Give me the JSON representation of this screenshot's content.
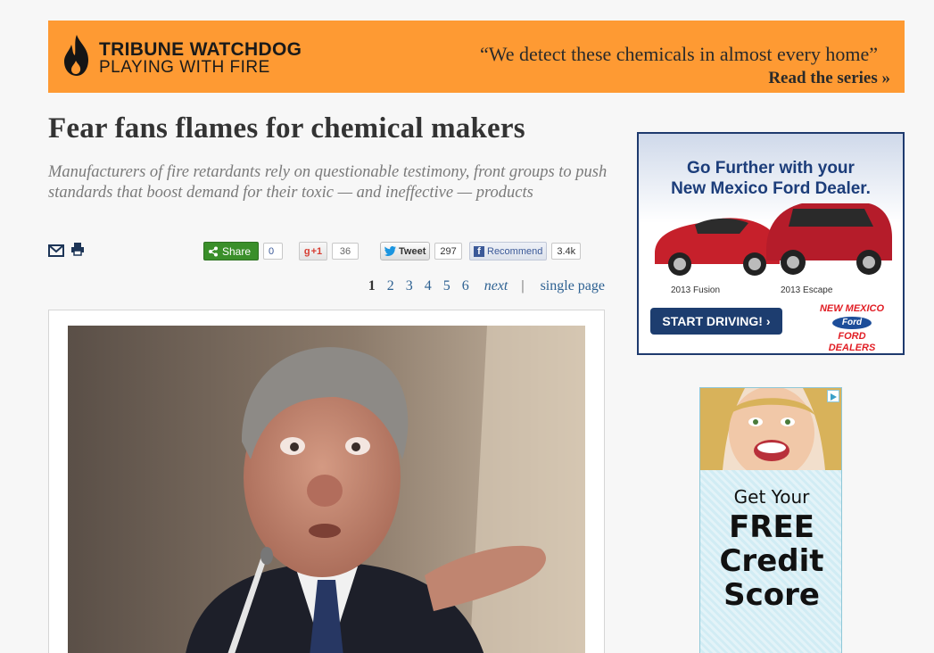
{
  "banner": {
    "brand_line1": "TRIBUNE WATCHDOG",
    "brand_line2": "PLAYING WITH FIRE",
    "quote": "“We detect these chemicals in almost every home”",
    "read_series": "Read the series »",
    "bg_color": "#fe9a33"
  },
  "article": {
    "headline": "Fear fans flames for chemical makers",
    "dek": "Manufacturers of fire retardants rely on questionable testimony, front groups to push standards that boost demand for their toxic — and ineffective — products"
  },
  "tools": {
    "email_icon": "envelope-icon",
    "print_icon": "printer-icon"
  },
  "social": {
    "share_label": "Share",
    "share_count": "0",
    "gplus_label": "+1",
    "gplus_count": "36",
    "tweet_label": "Tweet",
    "tweet_count": "297",
    "recommend_label": "Recommend",
    "recommend_count": "3.4k"
  },
  "pager": {
    "pages": [
      "1",
      "2",
      "3",
      "4",
      "5",
      "6"
    ],
    "current": "1",
    "next_label": "next",
    "separator": "|",
    "single_label": "single page"
  },
  "ads": {
    "ford": {
      "line1": "Go Further with your",
      "line2": "New Mexico Ford Dealer.",
      "car1": "2013 Fusion",
      "car2": "2013 Escape",
      "cta": "START DRIVING!",
      "dealer_logo_line1": "NEW MEXICO",
      "dealer_logo_mid": "Ford",
      "dealer_logo_line2": "FORD DEALERS"
    },
    "credit": {
      "line1": "Get Your",
      "line2": "FREE",
      "line3": "Credit",
      "line4": "Score"
    }
  }
}
